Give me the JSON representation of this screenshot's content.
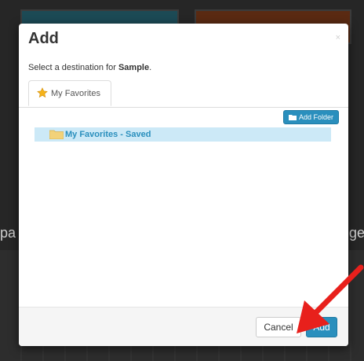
{
  "background": {
    "left_text": "pa",
    "right_text": "ge"
  },
  "modal": {
    "title": "Add",
    "close_label": "×",
    "instruction_prefix": "Select a destination for ",
    "instruction_target": "Sample",
    "instruction_suffix": ".",
    "tabs": [
      {
        "label": "My Favorites",
        "icon": "star-icon",
        "active": true
      }
    ],
    "add_folder_label": "Add Folder",
    "tree": [
      {
        "label": "My Favorites - Saved",
        "icon": "folder-icon",
        "selected": true
      }
    ],
    "footer": {
      "cancel_label": "Cancel",
      "add_label": "Add"
    }
  },
  "colors": {
    "primary": "#2a8fbd",
    "selection": "#cce9f7",
    "arrow": "#e8201c",
    "folder": "#f2d27a"
  }
}
